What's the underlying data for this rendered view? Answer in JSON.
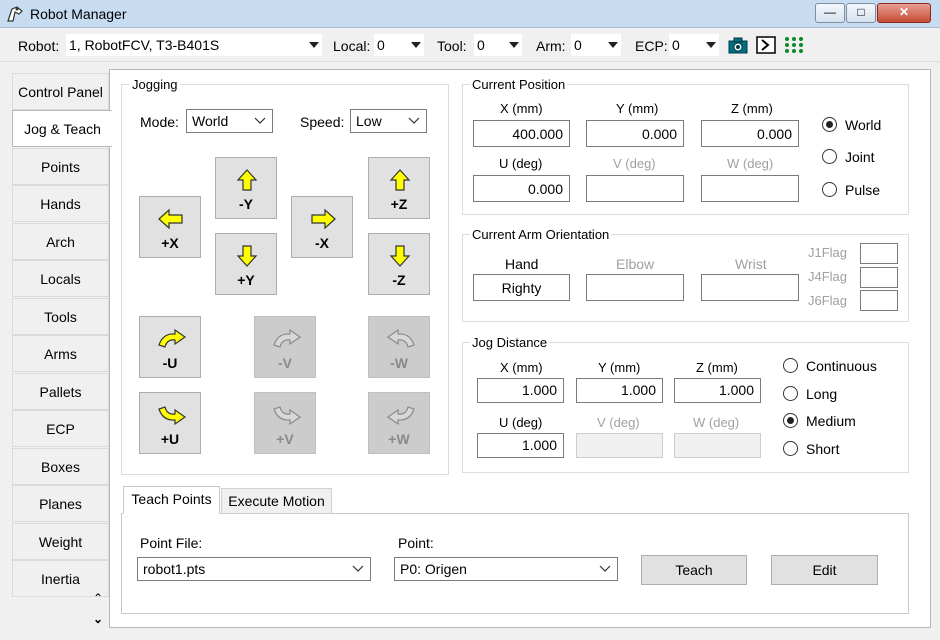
{
  "window": {
    "title": "Robot Manager",
    "minimize": "—",
    "maximize": "□",
    "close": "✕"
  },
  "toolbar": {
    "robot_label": "Robot:",
    "robot_value": "1, RobotFCV, T3-B401S",
    "local_label": "Local:",
    "local_value": "0",
    "tool_label": "Tool:",
    "tool_value": "0",
    "arm_label": "Arm:",
    "arm_value": "0",
    "ecp_label": "ECP:",
    "ecp_value": "0",
    "icons": [
      "camera-icon",
      "command-prompt-icon",
      "io-grid-icon"
    ]
  },
  "sidebar": {
    "items": [
      "Control Panel",
      "Jog & Teach",
      "Points",
      "Hands",
      "Arch",
      "Locals",
      "Tools",
      "Arms",
      "Pallets",
      "ECP",
      "Boxes",
      "Planes",
      "Weight",
      "Inertia"
    ],
    "active_index": 1,
    "scroll_up": "⌃",
    "scroll_down": "⌄"
  },
  "jogging": {
    "title": "Jogging",
    "mode_label": "Mode:",
    "mode_value": "World",
    "speed_label": "Speed:",
    "speed_value": "Low",
    "buttons": {
      "plus_x": "+X",
      "minus_x": "-X",
      "minus_y": "-Y",
      "plus_y": "+Y",
      "plus_z": "+Z",
      "minus_z": "-Z",
      "minus_u": "-U",
      "minus_v": "-V",
      "minus_w": "-W",
      "plus_u": "+U",
      "plus_v": "+V",
      "plus_w": "+W"
    }
  },
  "current_position": {
    "title": "Current Position",
    "x_label": "X (mm)",
    "x_value": "400.000",
    "y_label": "Y (mm)",
    "y_value": "0.000",
    "z_label": "Z (mm)",
    "z_value": "0.000",
    "u_label": "U (deg)",
    "u_value": "0.000",
    "v_label": "V (deg)",
    "v_value": "",
    "w_label": "W (deg)",
    "w_value": "",
    "options": [
      "World",
      "Joint",
      "Pulse"
    ],
    "selected": "World"
  },
  "arm_orientation": {
    "title": "Current Arm Orientation",
    "hand_label": "Hand",
    "hand_value": "Righty",
    "elbow_label": "Elbow",
    "elbow_value": "",
    "wrist_label": "Wrist",
    "wrist_value": "",
    "j1flag_label": "J1Flag",
    "j4flag_label": "J4Flag",
    "j6flag_label": "J6Flag"
  },
  "jog_distance": {
    "title": "Jog Distance",
    "x_label": "X (mm)",
    "x_value": "1.000",
    "y_label": "Y (mm)",
    "y_value": "1.000",
    "z_label": "Z (mm)",
    "z_value": "1.000",
    "u_label": "U (deg)",
    "u_value": "1.000",
    "v_label": "V (deg)",
    "v_value": "",
    "w_label": "W (deg)",
    "w_value": "",
    "options": [
      "Continuous",
      "Long",
      "Medium",
      "Short"
    ],
    "selected": "Medium"
  },
  "bottom": {
    "tabs": [
      "Teach Points",
      "Execute Motion"
    ],
    "active_tab": "Teach Points",
    "point_file_label": "Point File:",
    "point_file_value": "robot1.pts",
    "point_label": "Point:",
    "point_value": "P0: Origen",
    "teach_button": "Teach",
    "edit_button": "Edit"
  },
  "colors": {
    "titlebar": "#c8dcf1",
    "arrow_fill": "#ffff00",
    "close_button": "#c74b33"
  }
}
